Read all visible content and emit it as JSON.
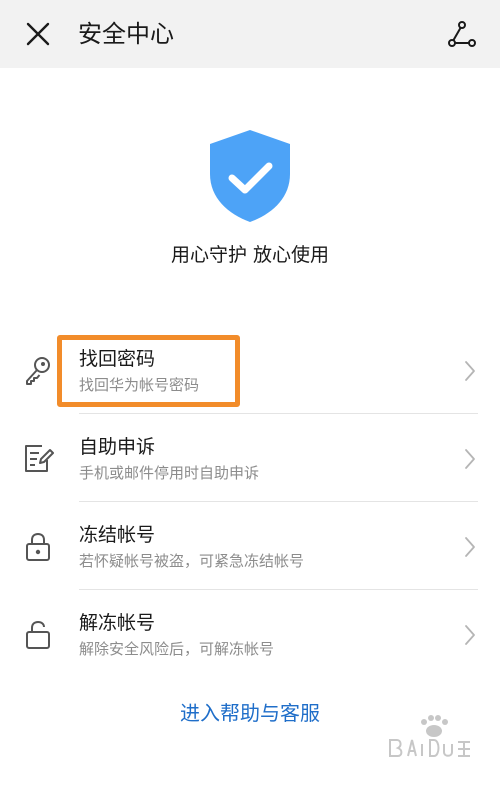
{
  "header": {
    "title": "安全中心",
    "close_icon": "close-icon",
    "share_icon": "share-icon"
  },
  "hero": {
    "icon": "shield-check-icon",
    "shield_color": "#4da3f7",
    "slogan": "用心守护 放心使用"
  },
  "menu": [
    {
      "icon": "key-icon",
      "title": "找回密码",
      "subtitle": "找回华为帐号密码"
    },
    {
      "icon": "edit-document-icon",
      "title": "自助申诉",
      "subtitle": "手机或邮件停用时自助申诉"
    },
    {
      "icon": "lock-icon",
      "title": "冻结帐号",
      "subtitle": "若怀疑帐号被盗，可紧急冻结帐号"
    },
    {
      "icon": "unlock-icon",
      "title": "解冻帐号",
      "subtitle": "解除安全风险后，可解冻帐号"
    }
  ],
  "help_link": "进入帮助与客服",
  "colors": {
    "header_bg": "#f2f2f2",
    "highlight": "#f28c2a",
    "link": "#1f6ec9"
  }
}
